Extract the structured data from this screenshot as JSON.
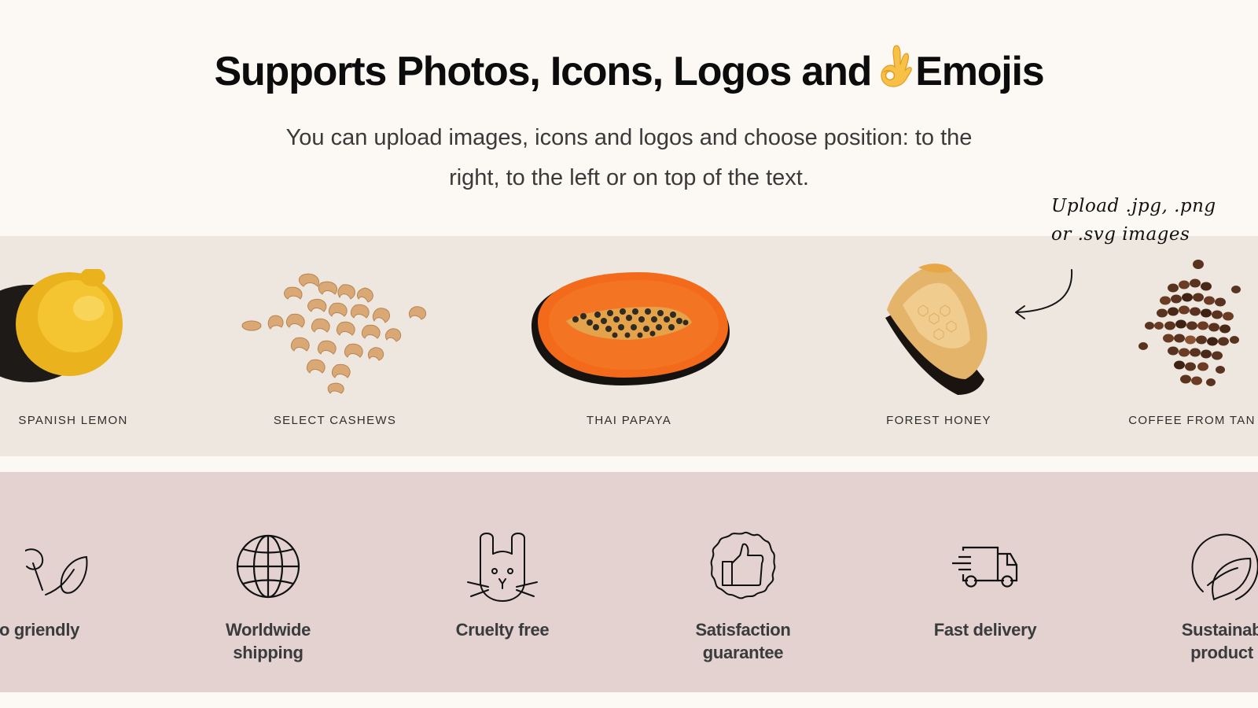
{
  "hero": {
    "title_before": "Supports Photos, Icons, Logos and",
    "title_emoji": "ok-hand-emoji",
    "title_after": "Emojis",
    "subtitle": "You can upload images, icons and logos and choose position: to the right, to the left or on top of the text."
  },
  "annotation": {
    "text": "Upload .jpg, .png\nor .svg images",
    "arrow_icon": "curved-arrow-left-icon"
  },
  "products": [
    {
      "label": "SPANISH LEMON",
      "image": "lemon-photo"
    },
    {
      "label": "SELECT CASHEWS",
      "image": "cashews-photo"
    },
    {
      "label": "THAI PAPAYA",
      "image": "papaya-photo"
    },
    {
      "label": "FOREST HONEY",
      "image": "honeycomb-photo"
    },
    {
      "label": "COFFEE FROM TAN",
      "image": "coffee-beans-photo"
    }
  ],
  "features": [
    {
      "label": "o griendly",
      "icon": "leaves-icon"
    },
    {
      "label": "Worldwide\nshipping",
      "icon": "globe-icon"
    },
    {
      "label": "Cruelty free",
      "icon": "bunny-icon"
    },
    {
      "label": "Satisfaction\nguarantee",
      "icon": "thumbs-up-badge-icon"
    },
    {
      "label": "Fast delivery",
      "icon": "delivery-truck-icon"
    },
    {
      "label": "Sustainab\nproduct",
      "icon": "leaf-circle-icon"
    }
  ],
  "colors": {
    "page_bg": "#fcf8f3",
    "photo_band_bg": "#eee7df",
    "icon_band_bg": "#e3d2d0",
    "title": "#0c0c0c",
    "body_text": "#3a3a3a"
  }
}
